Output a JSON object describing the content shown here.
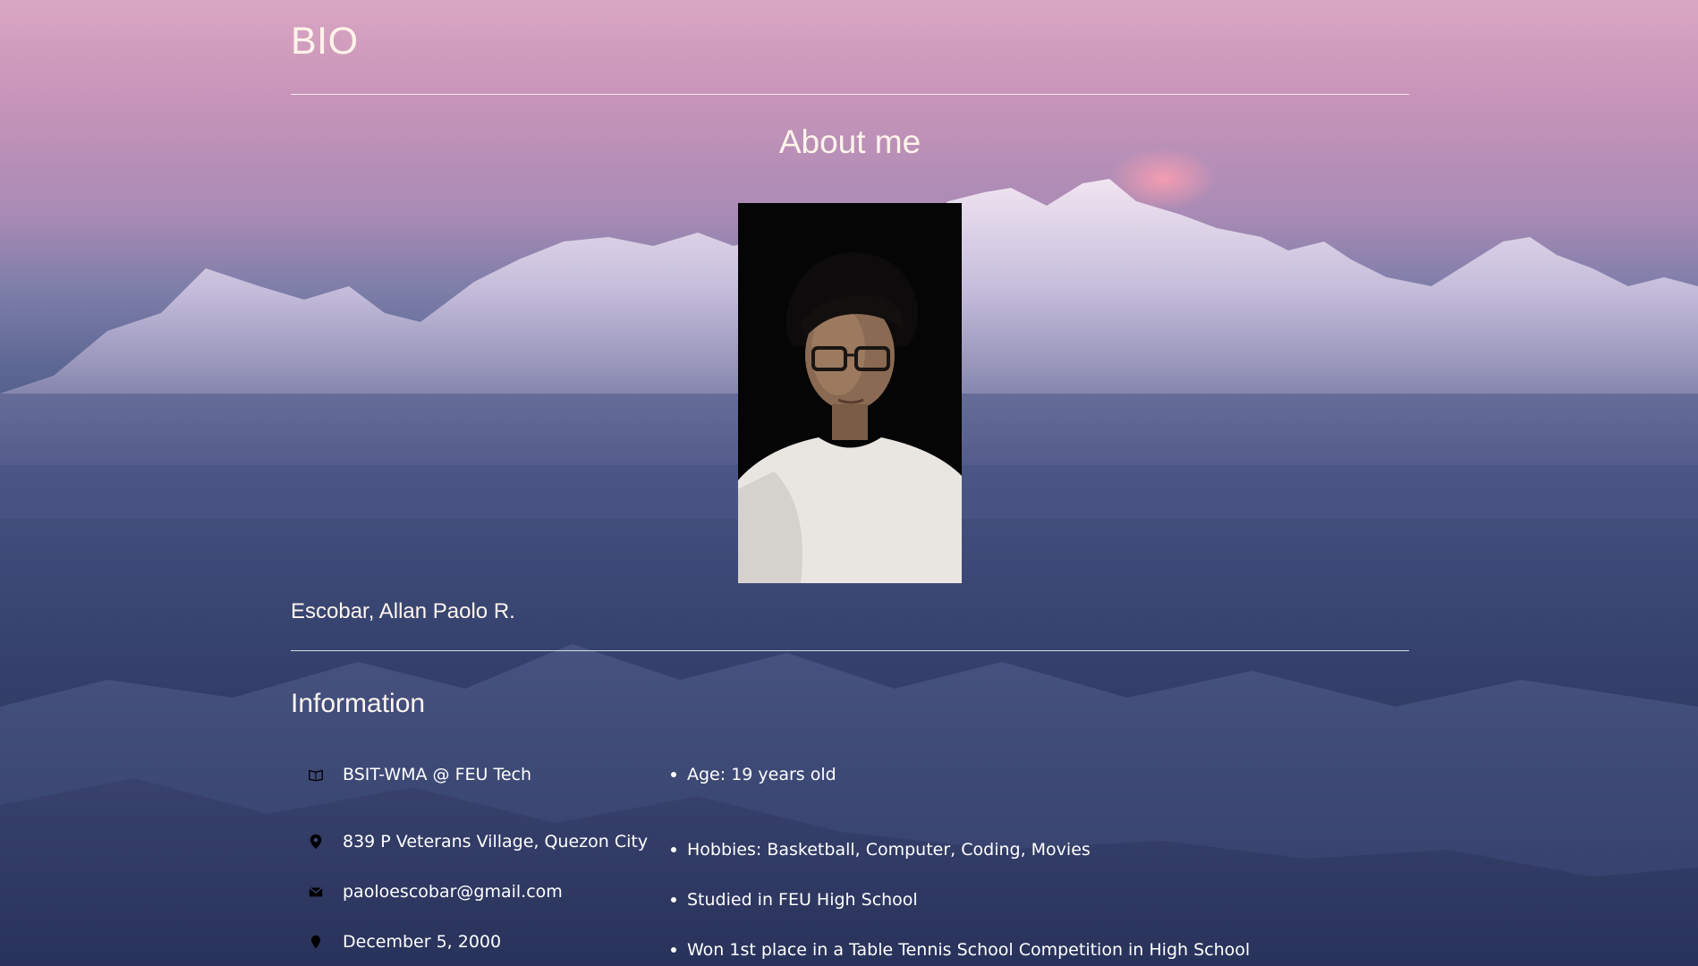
{
  "header": {
    "title": "BIO"
  },
  "about": {
    "title": "About me",
    "photo_alt": "profile-photo"
  },
  "profile": {
    "name": "Escobar, Allan Paolo R."
  },
  "information": {
    "title": "Information",
    "contacts": [
      {
        "icon": "book-icon",
        "text": "BSIT-WMA @ FEU Tech"
      },
      {
        "icon": "location-pin-icon",
        "text": "839 P Veterans Village, Quezon City"
      },
      {
        "icon": "envelope-icon",
        "text": "paoloescobar@gmail.com"
      },
      {
        "icon": "birthday-pin-icon",
        "text": "December 5, 2000"
      }
    ],
    "facts": [
      "Age: 19 years old",
      "Hobbies: Basketball, Computer, Coding, Movies",
      "Studied in FEU High School",
      "Won 1st place in a Table Tennis School Competition in High School"
    ]
  },
  "colors": {
    "heading_text": "#fff3ea",
    "body_text": "#ffffff",
    "sky_top": "#d9a6c2",
    "valley_bottom": "#26305a"
  }
}
